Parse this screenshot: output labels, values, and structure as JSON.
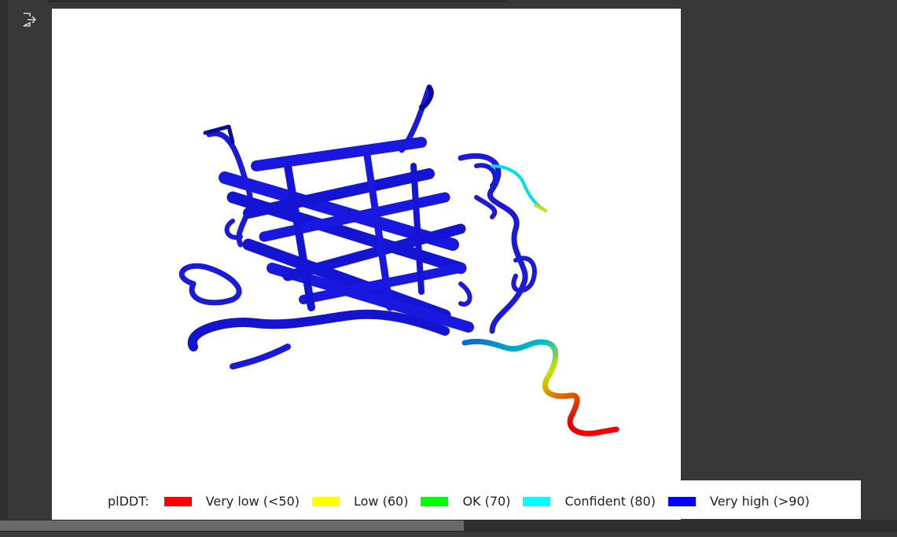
{
  "output_area": {
    "icon": "output-exit-icon"
  },
  "legend": {
    "title": "plDDT:",
    "entries": [
      {
        "label": "Very low (<50)",
        "color": "#ff0000"
      },
      {
        "label": "Low (60)",
        "color": "#ffff00"
      },
      {
        "label": "OK (70)",
        "color": "#00ff00"
      },
      {
        "label": "Confident (80)",
        "color": "#00ffff"
      },
      {
        "label": "Very high (>90)",
        "color": "#0000ff"
      }
    ]
  },
  "structure": {
    "main_color": "#1414e0",
    "tail_colors": [
      "#00ffff",
      "#ffff00",
      "#ff8000",
      "#ff0000"
    ]
  }
}
